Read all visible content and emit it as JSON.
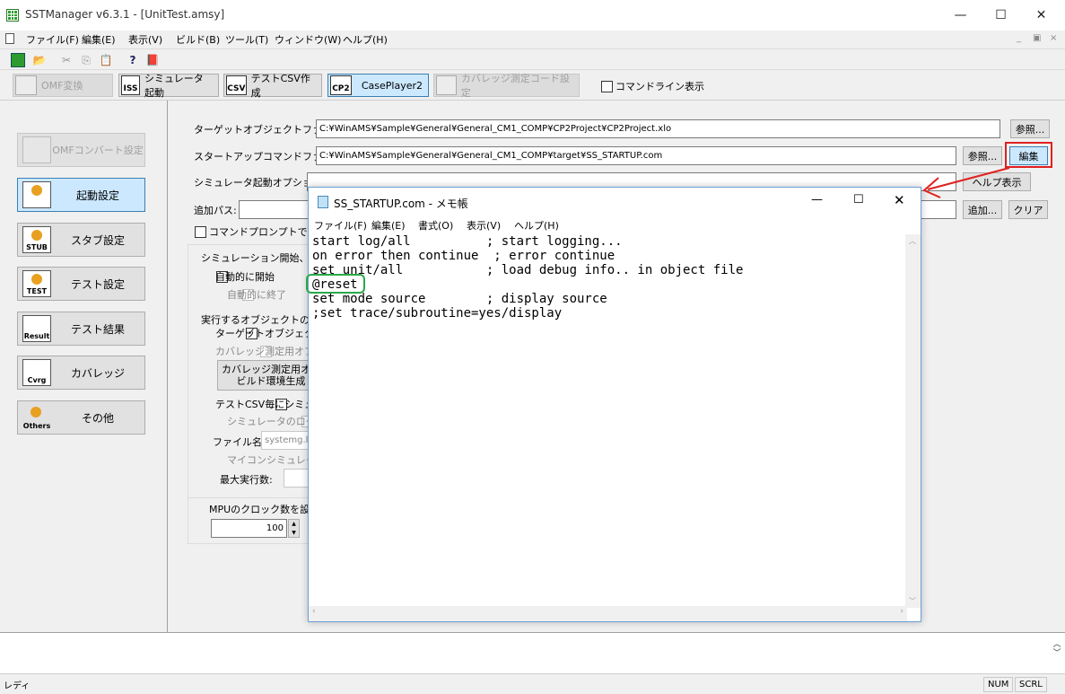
{
  "window": {
    "title": "SSTManager v6.3.1 - [UnitTest.amsy]",
    "controls": [
      "—",
      "☐",
      "✕"
    ]
  },
  "menubar": {
    "items": [
      "ファイル(F)",
      "編集(E)",
      "表示(V)",
      "ビルド(B)",
      "ツール(T)",
      "ウィンドウ(W)",
      "ヘルプ(H)"
    ],
    "mdi_controls": [
      "_",
      "▣",
      "×"
    ]
  },
  "toolbar2": {
    "omf": "OMF変換",
    "sim": "シミュレータ起動",
    "csv": "テストCSV作成",
    "cp2": "CasePlayer2",
    "coverage": "カバレッジ測定コード設定",
    "cmdline": "コマンドライン表示",
    "icon_labels": {
      "iss": "ISS",
      "csv": "CSV",
      "cp2": "CP2"
    }
  },
  "sidebar": {
    "omf_settings": "OMFコンバート設定",
    "items": [
      {
        "label": "起動設定",
        "icon": ""
      },
      {
        "label": "スタブ設定",
        "icon": "STUB"
      },
      {
        "label": "テスト設定",
        "icon": "TEST"
      },
      {
        "label": "テスト結果",
        "icon": "Result"
      },
      {
        "label": "カバレッジ",
        "icon": "Cvrg"
      },
      {
        "label": "その他",
        "icon": "Others"
      }
    ]
  },
  "form": {
    "target_label": "ターゲットオブジェクトファイル:",
    "target_value": "C:¥WinAMS¥Sample¥General¥General_CM1_COMP¥CP2Project¥CP2Project.xlo",
    "browse": "参照...",
    "startup_label": "スタートアップコマンドファイル:",
    "startup_value": "C:¥WinAMS¥Sample¥General¥General_CM1_COMP¥target¥SS_STARTUP.com",
    "edit": "編集",
    "simopt_label": "シミュレータ起動オプション:",
    "help_show": "ヘルプ表示",
    "addpath_label": "追加パス:",
    "add": "追加...",
    "clear": "クリア",
    "cmdprompt": "コマンドプロンプトで実行",
    "sim_group": "シミュレーション開始、終了",
    "auto_start": "自動的に開始",
    "auto_end": "自動的に終了",
    "exec_obj": "実行するオブジェクトの指定",
    "target_obj": "ターゲットオブジェクトファイル",
    "coverage_obj": "カバレッジ測定用オブジェクト",
    "coverage_build_1": "カバレッジ測定用オブ",
    "coverage_build_2": "ビルド環境生成",
    "csv_each": "テストCSV毎にシミュレータ",
    "sim_log": "シミュレータのログファイル",
    "filename_label": "ファイル名:",
    "filename_value": "systemg.lo",
    "mcu_sim": "マイコンシミュレータを",
    "max_exec": "最大実行数:",
    "mpu_clock": "MPUのクロック数を設定",
    "clock_value": "100"
  },
  "notepad": {
    "title": "SS_STARTUP.com - メモ帳",
    "menu": [
      "ファイル(F)",
      "編集(E)",
      "書式(O)",
      "表示(V)",
      "ヘルプ(H)"
    ],
    "lines": [
      "start log/all          ; start logging...",
      "on error then continue  ; error continue",
      "set unit/all           ; load debug info.. in object file",
      "@reset",
      "set mode source        ; display source",
      ";set trace/subroutine=yes/display"
    ]
  },
  "statusbar": {
    "ready": "レディ",
    "num": "NUM",
    "scrl": "SCRL"
  },
  "colors": {
    "highlight_red": "#e02020",
    "highlight_green": "#2aa84a",
    "active_button": "#cce8ff"
  }
}
